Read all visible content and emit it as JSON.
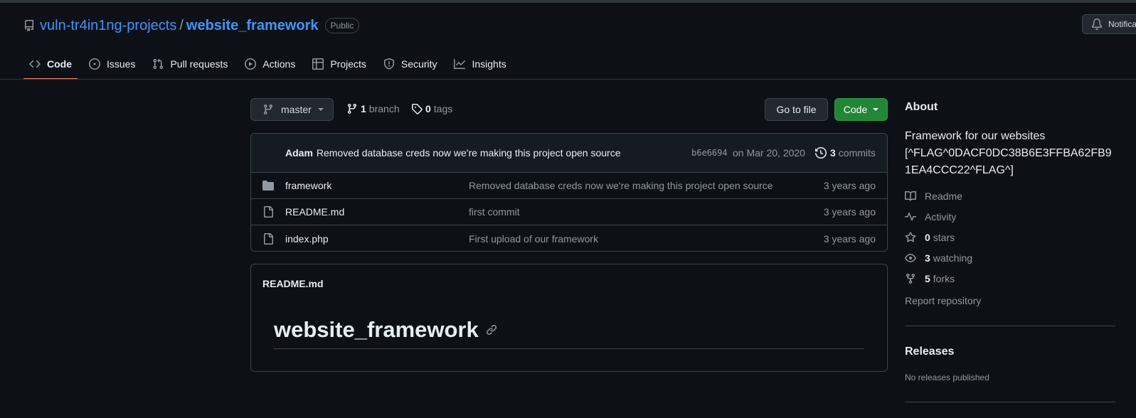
{
  "header": {
    "owner": "vuln-tr4in1ng-projects",
    "separator": "/",
    "repo": "website_framework",
    "visibility": "Public",
    "notifications_label": "Notifications"
  },
  "tabs": [
    {
      "label": "Code",
      "icon": "code-icon",
      "active": true
    },
    {
      "label": "Issues",
      "icon": "issue-opened-icon"
    },
    {
      "label": "Pull requests",
      "icon": "git-pull-request-icon"
    },
    {
      "label": "Actions",
      "icon": "play-icon"
    },
    {
      "label": "Projects",
      "icon": "table-icon"
    },
    {
      "label": "Security",
      "icon": "shield-icon"
    },
    {
      "label": "Insights",
      "icon": "graph-icon"
    }
  ],
  "branch_bar": {
    "current_branch": "master",
    "branch_count": "1",
    "branch_label": "branch",
    "tag_count": "0",
    "tag_label": "tags",
    "go_to_file": "Go to file",
    "code_button": "Code"
  },
  "latest_commit": {
    "author": "Adam",
    "message": "Removed database creds now we're making this project open source",
    "sha": "b6e6694",
    "date": "on Mar 20, 2020",
    "commit_count": "3",
    "commits_label": "commits"
  },
  "files": [
    {
      "name": "framework",
      "type": "folder",
      "message": "Removed database creds now we're making this project open source",
      "age": "3 years ago"
    },
    {
      "name": "README.md",
      "type": "file",
      "message": "first commit",
      "age": "3 years ago"
    },
    {
      "name": "index.php",
      "type": "file",
      "message": "First upload of our framework",
      "age": "3 years ago"
    }
  ],
  "readme": {
    "filename": "README.md",
    "heading": "website_framework"
  },
  "about": {
    "title": "About",
    "description_line1": "Framework for our websites",
    "description_line2": "[^FLAG^0DACF0DC38B6E3FFBA62FB9",
    "description_line3": "1EA4CCC22^FLAG^]",
    "readme": "Readme",
    "activity": "Activity",
    "stars_count": "0",
    "stars_label": "stars",
    "watching_count": "3",
    "watching_label": "watching",
    "forks_count": "5",
    "forks_label": "forks",
    "report": "Report repository"
  },
  "releases": {
    "title": "Releases",
    "empty": "No releases published"
  },
  "colors": {
    "background": "#0d1117",
    "link": "#4493f8",
    "active_tab_underline": "#f78166",
    "primary_button": "#238636",
    "border": "#3d444d",
    "muted_text": "#9198a1"
  }
}
